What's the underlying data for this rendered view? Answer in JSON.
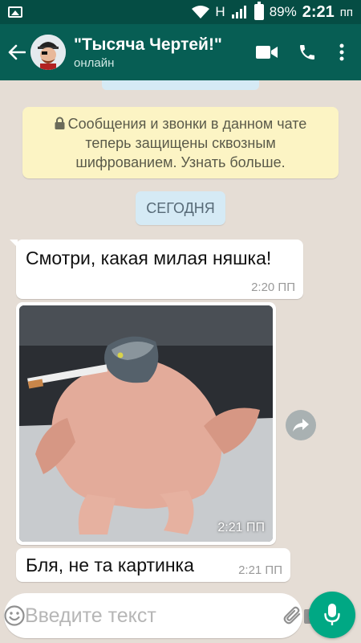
{
  "status_bar": {
    "network_type": "H",
    "battery_percent": "89%",
    "time": "2:21",
    "time_suffix": "пп"
  },
  "header": {
    "chat_title": "\"Тысяча Чертей!\"",
    "status": "онлайн",
    "icons": [
      "back-arrow-icon",
      "video-call-icon",
      "phone-icon",
      "more-vert-icon"
    ]
  },
  "chat": {
    "encryption_notice": "Сообщения и звонки в данном чате теперь защищены сквозным шифрованием. Узнать больше.",
    "date_label": "СЕГОДНЯ",
    "messages": [
      {
        "type": "text",
        "text": "Смотри, какая милая няшка!",
        "time": "2:20 ПП"
      },
      {
        "type": "image",
        "time": "2:21 ПП"
      },
      {
        "type": "text",
        "text": "Бля, не та картинка",
        "time": "2:21 ПП"
      }
    ]
  },
  "composer": {
    "placeholder": "Введите текст",
    "value": ""
  },
  "colors": {
    "header": "#075e54",
    "status_bar": "#054d44",
    "chat_background": "#e5ddd5",
    "accent": "#00a884",
    "encryption_bg": "#fcf4c4",
    "date_pill_bg": "#d5eaf5"
  }
}
